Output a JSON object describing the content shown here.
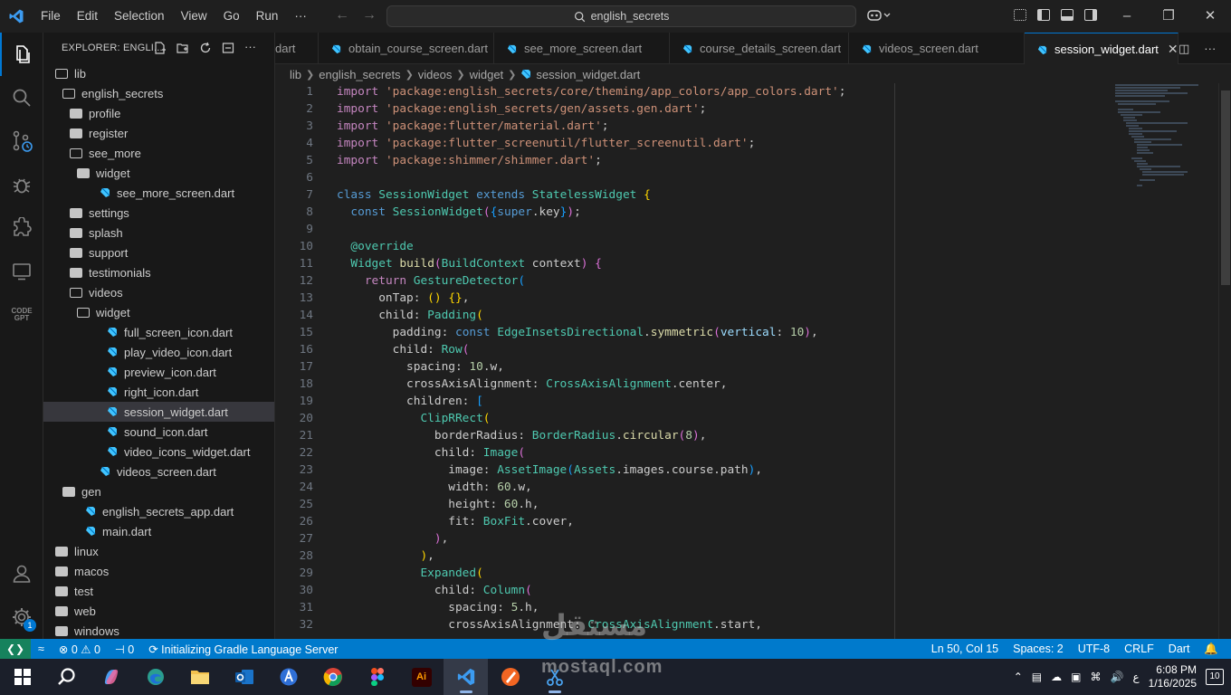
{
  "titlebar": {
    "menu": [
      "File",
      "Edit",
      "Selection",
      "View",
      "Go",
      "Run",
      "···"
    ],
    "search": "english_secrets",
    "window_controls": [
      "minimize",
      "restore",
      "close"
    ]
  },
  "activity_bar": {
    "items": [
      "explorer-icon",
      "search-icon",
      "source-control-icon",
      "run-debug-icon",
      "extensions-icon",
      "remote-explorer-icon",
      "codegpt-icon"
    ],
    "bottom": [
      "accounts-icon",
      "manage-gear-icon"
    ],
    "manage_badge": "1",
    "codegpt_label": "CODE GPT"
  },
  "sidebar": {
    "title": "EXPLORER: ENGLI...",
    "tree": [
      {
        "label": "lib",
        "kind": "folder-open",
        "depth": 0
      },
      {
        "label": "english_secrets",
        "kind": "folder-open",
        "depth": 1
      },
      {
        "label": "profile",
        "kind": "folder",
        "depth": 2
      },
      {
        "label": "register",
        "kind": "folder",
        "depth": 2
      },
      {
        "label": "see_more",
        "kind": "folder-open",
        "depth": 2
      },
      {
        "label": "widget",
        "kind": "folder",
        "depth": 3
      },
      {
        "label": "see_more_screen.dart",
        "kind": "dart",
        "depth": 3
      },
      {
        "label": "settings",
        "kind": "folder",
        "depth": 2
      },
      {
        "label": "splash",
        "kind": "folder",
        "depth": 2
      },
      {
        "label": "support",
        "kind": "folder",
        "depth": 2
      },
      {
        "label": "testimonials",
        "kind": "folder",
        "depth": 2
      },
      {
        "label": "videos",
        "kind": "folder-open",
        "depth": 2
      },
      {
        "label": "widget",
        "kind": "folder-open",
        "depth": 3
      },
      {
        "label": "full_screen_icon.dart",
        "kind": "dart",
        "depth": 4
      },
      {
        "label": "play_video_icon.dart",
        "kind": "dart",
        "depth": 4
      },
      {
        "label": "preview_icon.dart",
        "kind": "dart",
        "depth": 4
      },
      {
        "label": "right_icon.dart",
        "kind": "dart",
        "depth": 4
      },
      {
        "label": "session_widget.dart",
        "kind": "dart",
        "depth": 4,
        "selected": true
      },
      {
        "label": "sound_icon.dart",
        "kind": "dart",
        "depth": 4
      },
      {
        "label": "video_icons_widget.dart",
        "kind": "dart",
        "depth": 4
      },
      {
        "label": "videos_screen.dart",
        "kind": "dart",
        "depth": 3
      },
      {
        "label": "gen",
        "kind": "folder",
        "depth": 1
      },
      {
        "label": "english_secrets_app.dart",
        "kind": "dart",
        "depth": 1
      },
      {
        "label": "main.dart",
        "kind": "dart",
        "depth": 1
      },
      {
        "label": "linux",
        "kind": "folder",
        "depth": 0
      },
      {
        "label": "macos",
        "kind": "folder",
        "depth": 0
      },
      {
        "label": "test",
        "kind": "folder",
        "depth": 0
      },
      {
        "label": "web",
        "kind": "folder",
        "depth": 0
      },
      {
        "label": "windows",
        "kind": "folder",
        "depth": 0
      }
    ]
  },
  "tabs": [
    {
      "label": "dart",
      "active": false,
      "partial": true
    },
    {
      "label": "obtain_course_screen.dart",
      "active": false
    },
    {
      "label": "see_more_screen.dart",
      "active": false
    },
    {
      "label": "course_details_screen.dart",
      "active": false
    },
    {
      "label": "videos_screen.dart",
      "active": false
    },
    {
      "label": "session_widget.dart",
      "active": true
    }
  ],
  "breadcrumb": [
    "lib",
    "english_secrets",
    "videos",
    "widget",
    "session_widget.dart"
  ],
  "code_lines": [
    [
      [
        "k2",
        "import"
      ],
      [
        "p",
        " "
      ],
      [
        "s",
        "'package:english_secrets/core/theming/app_colors/app_colors.dart'"
      ],
      [
        "p",
        ";"
      ]
    ],
    [
      [
        "k2",
        "import"
      ],
      [
        "p",
        " "
      ],
      [
        "s",
        "'package:english_secrets/gen/assets.gen.dart'"
      ],
      [
        "p",
        ";"
      ]
    ],
    [
      [
        "k2",
        "import"
      ],
      [
        "p",
        " "
      ],
      [
        "s",
        "'package:flutter/material.dart'"
      ],
      [
        "p",
        ";"
      ]
    ],
    [
      [
        "k2",
        "import"
      ],
      [
        "p",
        " "
      ],
      [
        "s",
        "'package:flutter_screenutil/flutter_screenutil.dart'"
      ],
      [
        "p",
        ";"
      ]
    ],
    [
      [
        "k2",
        "import"
      ],
      [
        "p",
        " "
      ],
      [
        "s",
        "'package:shimmer/shimmer.dart'"
      ],
      [
        "p",
        ";"
      ]
    ],
    [],
    [
      [
        "k",
        "class"
      ],
      [
        "p",
        " "
      ],
      [
        "t",
        "SessionWidget"
      ],
      [
        "p",
        " "
      ],
      [
        "k",
        "extends"
      ],
      [
        "p",
        " "
      ],
      [
        "t",
        "StatelessWidget"
      ],
      [
        "p",
        " "
      ],
      [
        "b1",
        "{"
      ]
    ],
    [
      [
        "p",
        "  "
      ],
      [
        "k",
        "const"
      ],
      [
        "p",
        " "
      ],
      [
        "t",
        "SessionWidget"
      ],
      [
        "b2",
        "("
      ],
      [
        "b3",
        "{"
      ],
      [
        "k",
        "super"
      ],
      [
        "p",
        ".key"
      ],
      [
        "b3",
        "}"
      ],
      [
        "b2",
        ")"
      ],
      [
        "p",
        ";"
      ]
    ],
    [],
    [
      [
        "p",
        "  "
      ],
      [
        "t",
        "@override"
      ]
    ],
    [
      [
        "p",
        "  "
      ],
      [
        "t",
        "Widget"
      ],
      [
        "p",
        " "
      ],
      [
        "f",
        "build"
      ],
      [
        "b2",
        "("
      ],
      [
        "t",
        "BuildContext"
      ],
      [
        "p",
        " context"
      ],
      [
        "b2",
        ")"
      ],
      [
        "p",
        " "
      ],
      [
        "b2",
        "{"
      ]
    ],
    [
      [
        "p",
        "    "
      ],
      [
        "k2",
        "return"
      ],
      [
        "p",
        " "
      ],
      [
        "t",
        "GestureDetector"
      ],
      [
        "b3",
        "("
      ]
    ],
    [
      [
        "p",
        "      onTap: "
      ],
      [
        "b1",
        "()"
      ],
      [
        "p",
        " "
      ],
      [
        "b1",
        "{}"
      ],
      [
        "p",
        ","
      ]
    ],
    [
      [
        "p",
        "      child: "
      ],
      [
        "t",
        "Padding"
      ],
      [
        "b1",
        "("
      ]
    ],
    [
      [
        "p",
        "        padding: "
      ],
      [
        "k",
        "const"
      ],
      [
        "p",
        " "
      ],
      [
        "t",
        "EdgeInsetsDirectional"
      ],
      [
        "p",
        "."
      ],
      [
        "f",
        "symmetric"
      ],
      [
        "b2",
        "("
      ],
      [
        "v",
        "vertical"
      ],
      [
        "p",
        ": "
      ],
      [
        "n",
        "10"
      ],
      [
        "b2",
        ")"
      ],
      [
        "p",
        ","
      ]
    ],
    [
      [
        "p",
        "        child: "
      ],
      [
        "t",
        "Row"
      ],
      [
        "b2",
        "("
      ]
    ],
    [
      [
        "p",
        "          spacing: "
      ],
      [
        "n",
        "10"
      ],
      [
        "p",
        ".w,"
      ]
    ],
    [
      [
        "p",
        "          crossAxisAlignment: "
      ],
      [
        "t",
        "CrossAxisAlignment"
      ],
      [
        "p",
        ".center,"
      ]
    ],
    [
      [
        "p",
        "          children: "
      ],
      [
        "b3",
        "["
      ]
    ],
    [
      [
        "p",
        "            "
      ],
      [
        "t",
        "ClipRRect"
      ],
      [
        "b1",
        "("
      ]
    ],
    [
      [
        "p",
        "              borderRadius: "
      ],
      [
        "t",
        "BorderRadius"
      ],
      [
        "p",
        "."
      ],
      [
        "f",
        "circular"
      ],
      [
        "b2",
        "("
      ],
      [
        "n",
        "8"
      ],
      [
        "b2",
        ")"
      ],
      [
        "p",
        ","
      ]
    ],
    [
      [
        "p",
        "              child: "
      ],
      [
        "t",
        "Image"
      ],
      [
        "b2",
        "("
      ]
    ],
    [
      [
        "p",
        "                image: "
      ],
      [
        "t",
        "AssetImage"
      ],
      [
        "b3",
        "("
      ],
      [
        "t",
        "Assets"
      ],
      [
        "p",
        ".images.course.path"
      ],
      [
        "b3",
        ")"
      ],
      [
        "p",
        ","
      ]
    ],
    [
      [
        "p",
        "                width: "
      ],
      [
        "n",
        "60"
      ],
      [
        "p",
        ".w,"
      ]
    ],
    [
      [
        "p",
        "                height: "
      ],
      [
        "n",
        "60"
      ],
      [
        "p",
        ".h,"
      ]
    ],
    [
      [
        "p",
        "                fit: "
      ],
      [
        "t",
        "BoxFit"
      ],
      [
        "p",
        ".cover,"
      ]
    ],
    [
      [
        "p",
        "              "
      ],
      [
        "b2",
        ")"
      ],
      [
        "p",
        ","
      ]
    ],
    [
      [
        "p",
        "            "
      ],
      [
        "b1",
        ")"
      ],
      [
        "p",
        ","
      ]
    ],
    [
      [
        "p",
        "            "
      ],
      [
        "t",
        "Expanded"
      ],
      [
        "b1",
        "("
      ]
    ],
    [
      [
        "p",
        "              child: "
      ],
      [
        "t",
        "Column"
      ],
      [
        "b2",
        "("
      ]
    ],
    [
      [
        "p",
        "                spacing: "
      ],
      [
        "n",
        "5"
      ],
      [
        "p",
        ".h,"
      ]
    ],
    [
      [
        "p",
        "                crossAxisAlignment: "
      ],
      [
        "t",
        "CrossAxisAlignment"
      ],
      [
        "p",
        ".start,"
      ]
    ]
  ],
  "statusbar": {
    "problems": "0",
    "warnings": "0",
    "ports": "0",
    "task": "Initializing Gradle Language Server",
    "position": "Ln 50, Col 15",
    "spaces": "Spaces: 2",
    "encoding": "UTF-8",
    "eol": "CRLF",
    "language": "Dart"
  },
  "taskbar": {
    "apps": [
      "windows-start-icon",
      "search-icon",
      "copilot-icon",
      "edge-icon",
      "file-explorer-icon",
      "outlook-icon",
      "app-a-icon",
      "chrome-icon",
      "figma-icon",
      "illustrator-icon",
      "vscode-icon",
      "app-orange-icon",
      "snipping-tool-icon"
    ],
    "keyboard": "ع",
    "time": "6:08 PM",
    "date": "1/16/2025",
    "notifications": "10"
  },
  "watermark": {
    "arabic": "مستقل",
    "latin": "mostaql.com"
  },
  "colors": {
    "accent": "#0078d4",
    "statusbar": "#007acc",
    "dart": "#40c4ff"
  }
}
